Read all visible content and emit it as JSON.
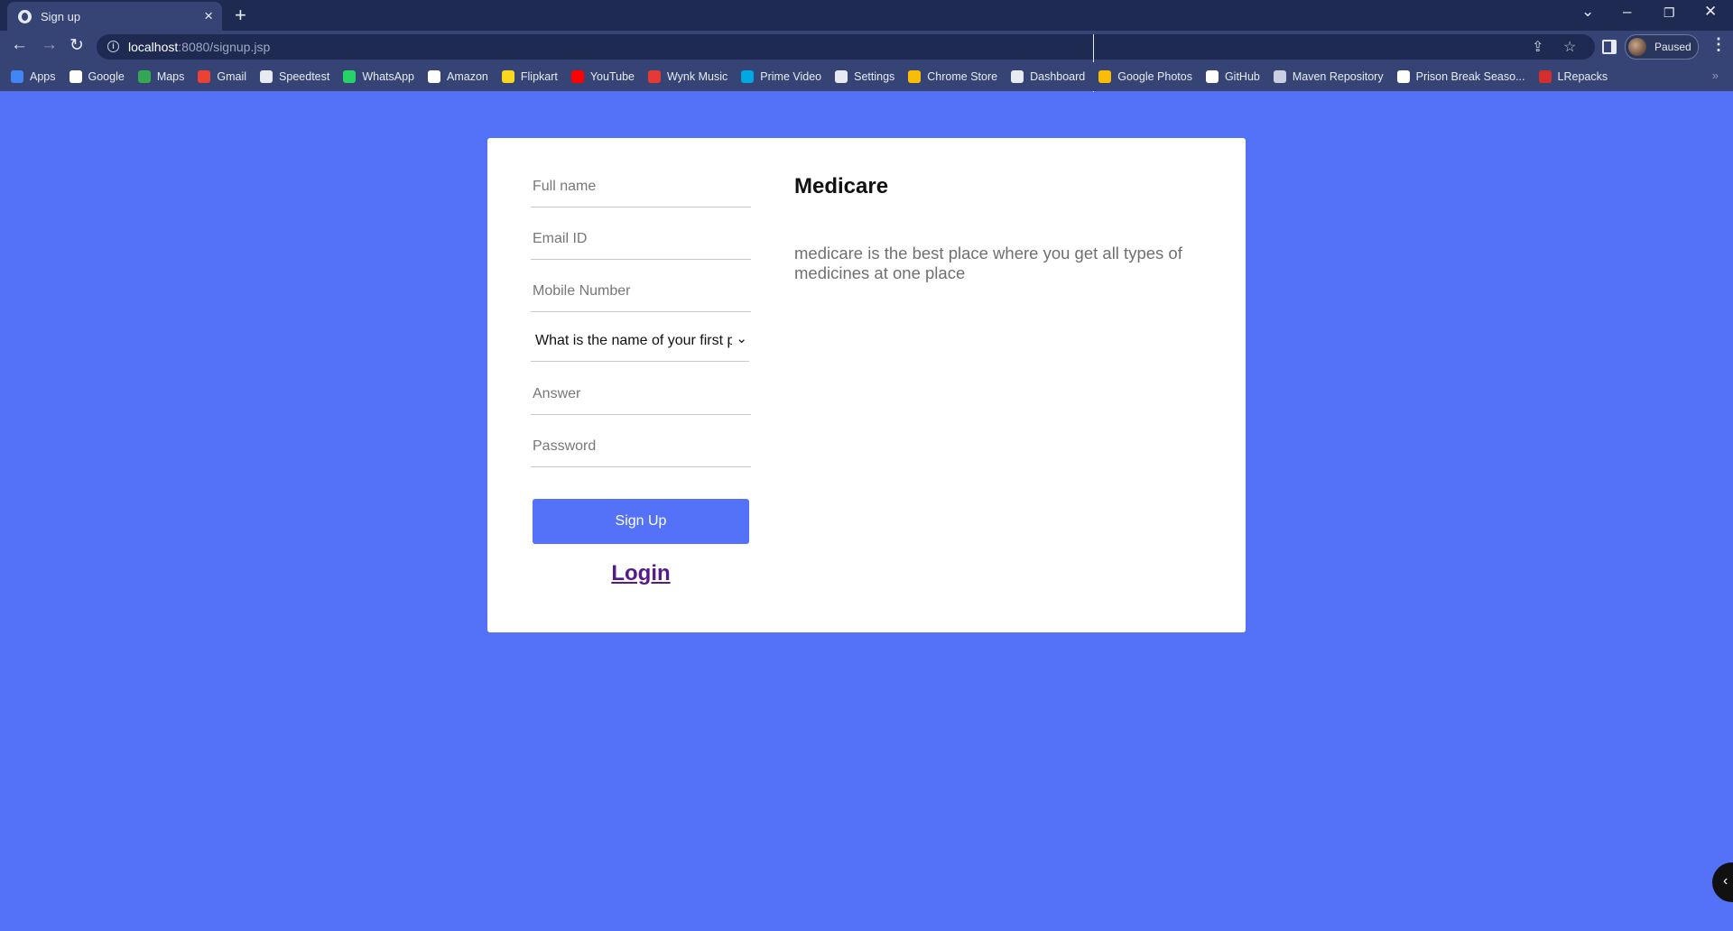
{
  "browser": {
    "tab_title": "Sign up",
    "url_host": "localhost",
    "url_rest": ":8080/signup.jsp",
    "profile_status": "Paused",
    "bookmarks": [
      {
        "label": "Apps",
        "icon": "apps-grid-icon",
        "color": "#4285f4"
      },
      {
        "label": "Google",
        "icon": "google-icon",
        "color": "#ffffff"
      },
      {
        "label": "Maps",
        "icon": "maps-icon",
        "color": "#34a853"
      },
      {
        "label": "Gmail",
        "icon": "gmail-icon",
        "color": "#ea4335"
      },
      {
        "label": "Speedtest",
        "icon": "speedtest-icon",
        "color": "#e8eaf2"
      },
      {
        "label": "WhatsApp",
        "icon": "whatsapp-icon",
        "color": "#25d366"
      },
      {
        "label": "Amazon",
        "icon": "amazon-icon",
        "color": "#ffffff"
      },
      {
        "label": "Flipkart",
        "icon": "flipkart-icon",
        "color": "#f9d71c"
      },
      {
        "label": "YouTube",
        "icon": "youtube-icon",
        "color": "#ff0000"
      },
      {
        "label": "Wynk Music",
        "icon": "wynk-icon",
        "color": "#e53935"
      },
      {
        "label": "Prime Video",
        "icon": "prime-video-icon",
        "color": "#00a8e1"
      },
      {
        "label": "Settings",
        "icon": "gear-icon",
        "color": "#e8eaf2"
      },
      {
        "label": "Chrome Store",
        "icon": "chrome-store-icon",
        "color": "#fbbc04"
      },
      {
        "label": "Dashboard",
        "icon": "dashboard-icon",
        "color": "#e8eaf2"
      },
      {
        "label": "Google Photos",
        "icon": "google-photos-icon",
        "color": "#fbbc04"
      },
      {
        "label": "GitHub",
        "icon": "github-icon",
        "color": "#ffffff"
      },
      {
        "label": "Maven Repository",
        "icon": "maven-icon",
        "color": "#c9cfe0"
      },
      {
        "label": "Prison Break Seaso...",
        "icon": "wordpress-icon",
        "color": "#ffffff"
      },
      {
        "label": "LRepacks",
        "icon": "lrepacks-icon",
        "color": "#d32f2f"
      }
    ]
  },
  "form": {
    "fullname_placeholder": "Full name",
    "email_placeholder": "Email ID",
    "mobile_placeholder": "Mobile Number",
    "security_question_selected": "What is the name of your first pet?",
    "answer_placeholder": "Answer",
    "password_placeholder": "Password",
    "signup_label": "Sign Up",
    "login_label": "Login"
  },
  "brand": {
    "title": "Medicare",
    "description": "medicare is the best place where you get all types of medicines at one place"
  },
  "colors": {
    "page_background": "#5472f7",
    "button": "#5472f7",
    "link": "#551a8b"
  }
}
